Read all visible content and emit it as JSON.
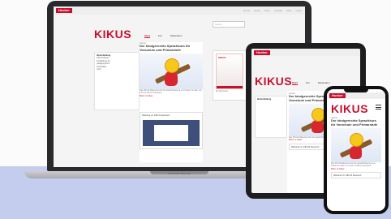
{
  "laptop": {
    "brand_tag": "Hueber",
    "top_links": [
      "Home",
      "Kurse",
      "Shop",
      "Kontakt",
      "Über",
      "Login"
    ],
    "logo": "KIKUS",
    "nav": [
      "Start",
      "Info",
      "Materialien"
    ],
    "search_placeholder": "Suche",
    "sidebox_title": "Weiterbildung",
    "sidebox_lines": [
      "KIKUS Basis",
      "Fortbildung für",
      "pädagogische",
      "Fachkräfte",
      "mehr"
    ],
    "kicker": "Aktuell",
    "headline": "Der kindgerechte Sprachkurs für Vorschule und Primarstufe",
    "body": "Das KIKUS-Material ist für die Sprachförderung von Kindern im Alter von 3 bis 10 Jahren konzipiert.",
    "more": "Mehr zu Kikus",
    "video_title": "Webinar zu KIKUS Deutsch",
    "book_label": "Die Buchreihe",
    "footer_label": "Notebook Mockup"
  },
  "tablet": {
    "brand_tag": "Hueber",
    "logo": "KIKUS",
    "nav": [
      "Start",
      "Info",
      "Materialien"
    ],
    "kicker": "Aktuell",
    "headline": "Der kindgerechte Sprachkurs für Vorschule und Primarstufe",
    "body": "Das KIKUS-Material ist für die Sprachförderung von Kindern konzipiert.",
    "more": "Mehr zu Kikus",
    "video_title": "Webinar zu KIKUS Deutsch",
    "sidebox_title": "Weiterbildung"
  },
  "phone": {
    "brand_tag": "Hueber",
    "logo": "KIKUS",
    "kicker": "Aktuell",
    "headline": "Der kindgerechte Sprachkurs für Vorschule und Primarstufe",
    "body": "Das KIKUS-Material ist für die Sprachförderung von Kindern im Alter von 3 bis 10 Jahren konzipiert.",
    "more": "Mehr zu Kikus",
    "video_title": "Webinar zu KIKUS Deutsch"
  },
  "colors": {
    "brand": "#c8102e",
    "accent": "#f7a800",
    "band": "#c5cdee"
  },
  "icons": [
    "menu-icon",
    "search-icon",
    "play-icon"
  ]
}
